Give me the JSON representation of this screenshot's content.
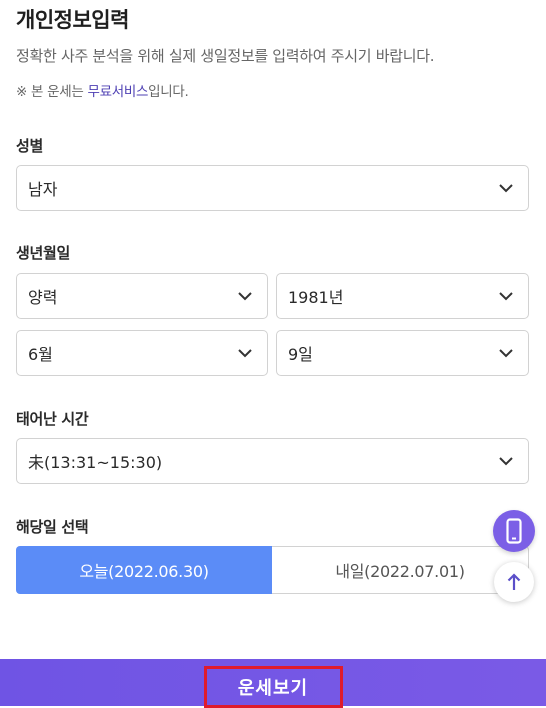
{
  "header": {
    "title": "개인정보입력",
    "description": "정확한 사주 분석을 위해 실제 생일정보를 입력하여 주시기 바랍니다.",
    "notice_prefix": "※ 본 운세는 ",
    "notice_highlight": "무료서비스",
    "notice_suffix": "입니다."
  },
  "gender": {
    "label": "성별",
    "value": "남자"
  },
  "birth": {
    "label": "생년월일",
    "calendar": "양력",
    "year": "1981년",
    "month": "6월",
    "day": "9일"
  },
  "birth_time": {
    "label": "태어난 시간",
    "value": "未(13:31~15:30)"
  },
  "target_date": {
    "label": "해당일 선택",
    "today": "오늘(2022.06.30)",
    "tomorrow": "내일(2022.07.01)"
  },
  "submit": {
    "label": "운세보기"
  },
  "icons": {
    "select_arrow": "chevron-down-icon",
    "fab_phone": "mobile-phone-icon",
    "fab_top": "arrow-up-icon"
  },
  "colors": {
    "accent_purple": "#7b5fe6",
    "segment_active": "#5b8cf7",
    "notice_highlight": "#4d3fb3",
    "bar_purple": "#6f54e4",
    "highlight_box": "#e01b2c"
  }
}
